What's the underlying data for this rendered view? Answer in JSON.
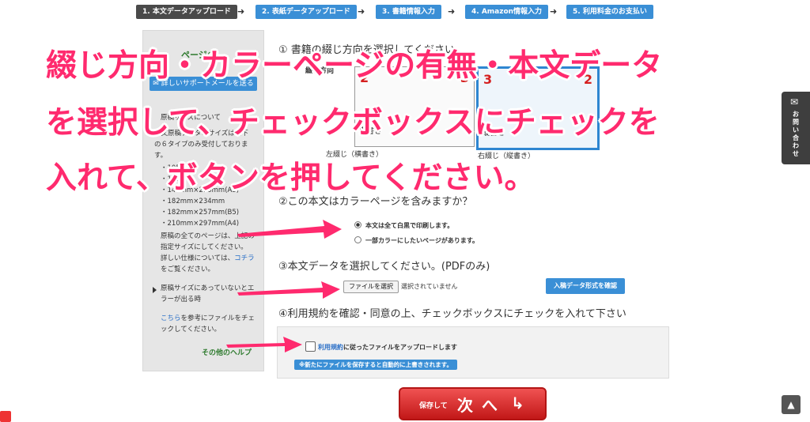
{
  "steps": [
    {
      "label": "1. 本文データアップロード",
      "active": true
    },
    {
      "label": "2. 表紙データアップロード",
      "active": false
    },
    {
      "label": "3. 書籍情報入力",
      "active": false
    },
    {
      "label": "4. Amazon情報入力",
      "active": false
    },
    {
      "label": "5. 利用料金のお支払い",
      "active": false
    }
  ],
  "sidebar": {
    "title": "ページの",
    "mail_button": "詳しいサポートメールを送る",
    "lines": [
      "原稿サイズについて",
      "本文原稿データのサイズは以下",
      "の６タイプのみ受付しておりま",
      "す。",
      "・105",
      "・128",
      "・148mm×210mm(A5)",
      "・182mm×234mm",
      "・182mm×257mm(B5)",
      "・210mm×297mm(A4)",
      "原稿の全てのページは、上記の",
      "指定サイズにしてください。",
      "詳しい仕様については、",
      "をご覧ください。"
    ],
    "here_link": "コチラ",
    "faq": [
      "原稿サイズにあっていないとエ",
      "ラーが出る時"
    ],
    "ref_link": "こちら",
    "ref_text": [
      "を参考にファイルをチェ",
      "ックしてください。"
    ],
    "help": "その他のヘルプ"
  },
  "binding": {
    "heading": "① 書籍の綴じ方向を選択してください",
    "row_label": "綴じ方向",
    "left_book": {
      "num_left": "2",
      "num_right": "3",
      "label": "横書き",
      "caption": "左綴じ（横書き）"
    },
    "right_book": {
      "num_left": "3",
      "num_right": "2",
      "label": "縦書き",
      "caption": "右綴じ（縦書き）"
    }
  },
  "color": {
    "heading": "②この本文はカラーページを含みますか？",
    "options": [
      "本文は全て白黒で印刷します。",
      "一部カラーにしたいページがあります。"
    ],
    "selected_index": 0
  },
  "file": {
    "heading": "③本文データを選択してください。(PDFのみ)",
    "choose_button": "ファイルを選択",
    "status": "選択されていません",
    "format_button": "入稿データ形式を確認"
  },
  "terms": {
    "heading": "④利用規約を確認・同意の上、チェックボックスにチェックを入れて下さい",
    "link": "利用規約",
    "text": "に従ったファイルをアップロードします",
    "note": "※新たにファイルを保存すると自動的に上書きされます。",
    "checked": false
  },
  "next": {
    "small": "保存して",
    "big": "次 へ",
    "arrow": "↳"
  },
  "contact": "お問い合わせ",
  "captions": [
    "綴じ方向・カラーページの有無・本文データ",
    "を選択して、チェックボックスにチェックを",
    "入れて、ボタンを押してください。"
  ],
  "colors": {
    "accent": "#3a8fd6",
    "caption": "#ff2a6e",
    "arrow": "#ff2a6e",
    "next": "#d92a2a"
  }
}
